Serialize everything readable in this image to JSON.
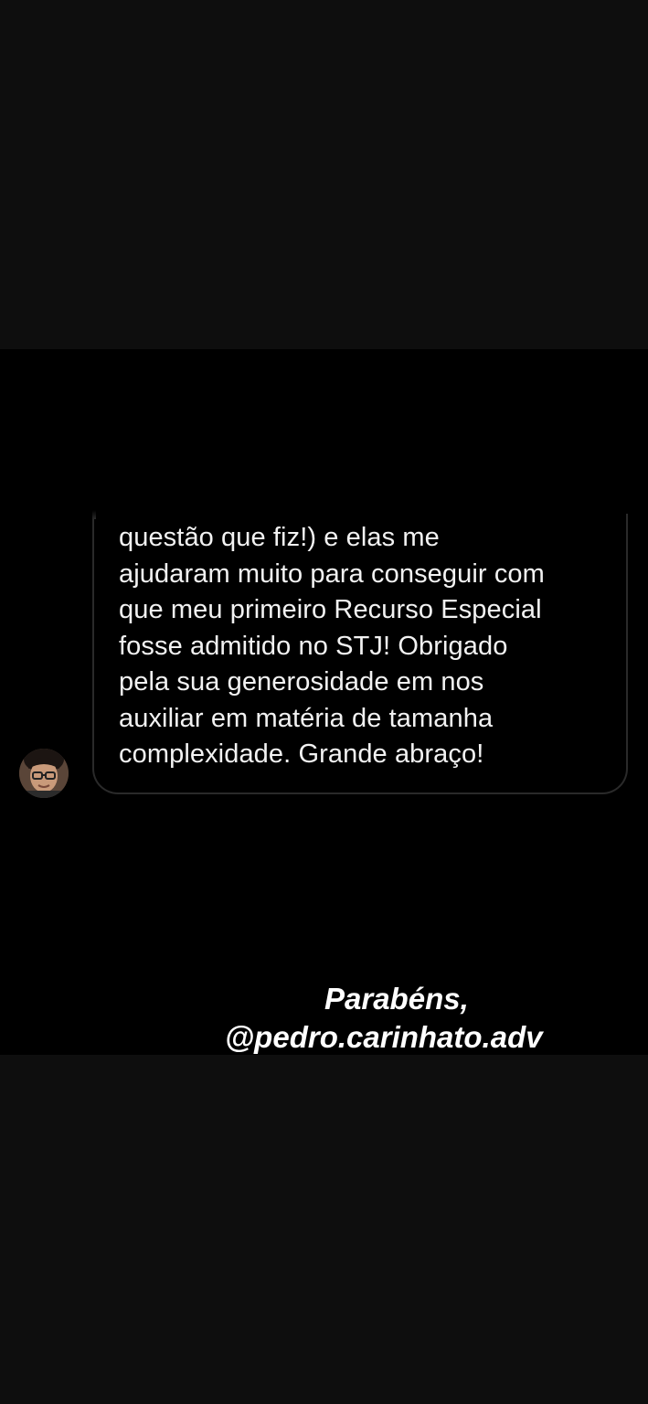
{
  "message": {
    "lines": [
      "questão que fiz!) e elas me",
      "ajudaram muito para conseguir com",
      "que meu primeiro Recurso Especial",
      "fosse admitido no STJ! Obrigado",
      "pela sua generosidade em nos",
      "auxiliar em matéria de tamanha",
      "complexidade. Grande abraço!"
    ]
  },
  "caption": {
    "line1": "Parabéns,",
    "line2": "@pedro.carinhato.adv"
  },
  "colors": {
    "story_background": "#000000",
    "band_background": "#0e0e0e",
    "text": "#f2f2f2",
    "bubble_border": "#2a2a2a"
  }
}
